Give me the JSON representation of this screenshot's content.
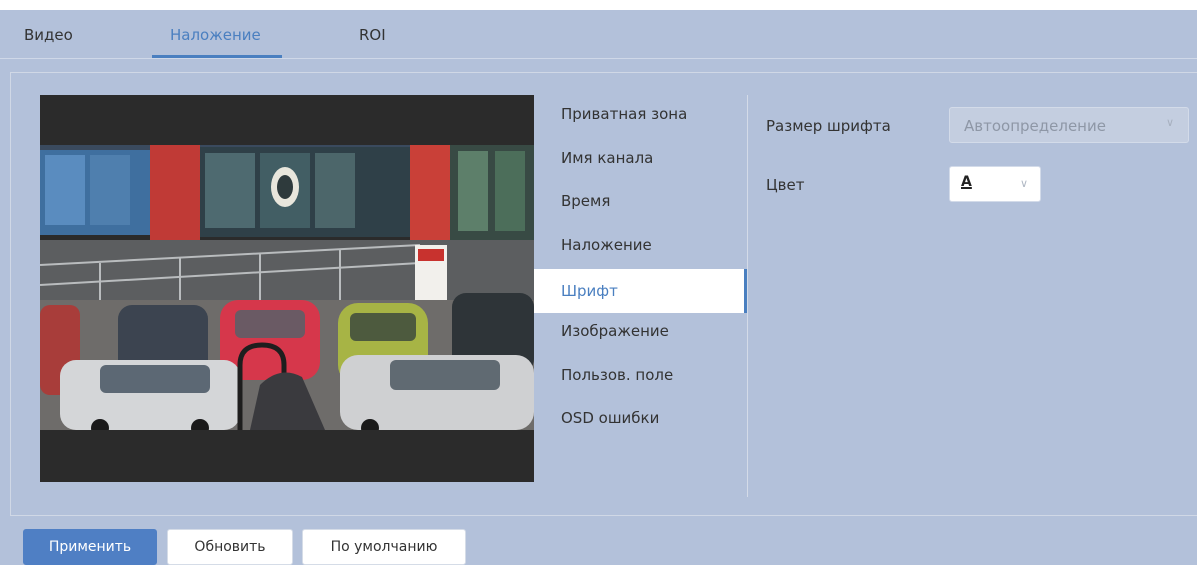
{
  "tabs": [
    "Видео",
    "Наложение",
    "ROI"
  ],
  "active_tab": "Наложение",
  "menu": {
    "items": [
      "Приватная зона",
      "Имя канала",
      "Время",
      "Наложение",
      "Шрифт",
      "Изображение",
      "Пользов. поле",
      "OSD ошибки"
    ],
    "selected": "Шрифт"
  },
  "settings": {
    "font_size_label": "Размер шрифта",
    "font_size_value": "Автоопределение",
    "color_label": "Цвет",
    "color_value": "A"
  },
  "buttons": {
    "apply": "Применить",
    "refresh": "Обновить",
    "default": "По умолчанию"
  },
  "colors": {
    "accent": "#4a7fc0",
    "background": "#b3c1da"
  },
  "icons": {
    "dropdown": "chevron-down-icon"
  }
}
